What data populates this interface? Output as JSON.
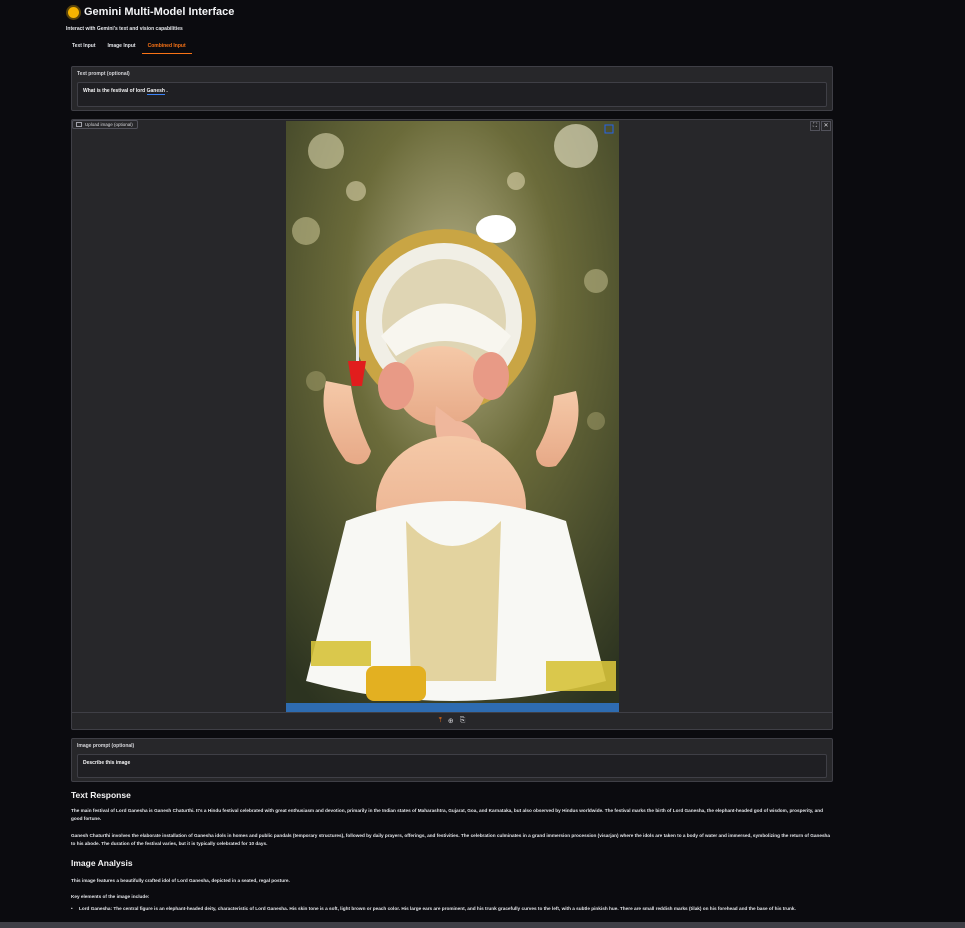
{
  "app": {
    "title": "Gemini Multi-Model Interface",
    "subtitle": "Interact with Gemini's text and vision capabilities",
    "icon": "sun-icon"
  },
  "tabs": [
    {
      "label": "Text Input",
      "active": false
    },
    {
      "label": "Image Input",
      "active": false
    },
    {
      "label": "Combined Input",
      "active": true
    }
  ],
  "text_prompt": {
    "label": "Text prompt (optional)",
    "value_before": "What is the festival of lord ",
    "value_underlined": "Ganesh",
    "value_after": " ."
  },
  "upload": {
    "label": "Upload image (optional)",
    "controls": [
      "⛶",
      "✕"
    ],
    "tools": [
      "⤒",
      "⊕",
      "⎘"
    ]
  },
  "image_prompt": {
    "label": "Image prompt (optional)",
    "value": "Describe this image"
  },
  "response": {
    "text_heading": "Text Response",
    "p1": "The main festival of Lord Ganesha is Ganesh Chaturthi. It's a Hindu festival celebrated with great enthusiasm and devotion, primarily in the Indian states of Maharashtra, Gujarat, Goa, and Karnataka, but also observed by Hindus worldwide. The festival marks the birth of Lord Ganesha, the elephant-headed god of wisdom, prosperity, and good fortune.",
    "p2": "Ganesh Chaturthi involves the elaborate installation of Ganesha idols in homes and public pandals (temporary structures), followed by daily prayers, offerings, and festivities. The celebration culminates in a grand immersion procession (visarjan) where the idols are taken to a body of water and immersed, symbolizing the return of Ganesha to his abode. The duration of the festival varies, but it is typically celebrated for 10 days.",
    "image_heading": "Image Analysis",
    "p3": "This image features a beautifully crafted idol of Lord Ganesha, depicted in a seated, regal posture.",
    "p4": "Key elements of the image include:",
    "li1": "Lord Ganesha: The central figure is an elephant-headed deity, characteristic of Lord Ganesha. His skin tone is a soft, light brown or peach color. His large ears are prominent, and his trunk gracefully curves to the left, with a subtle pinkish hue. There are small reddish marks (tilak) on his forehead and the base of his trunk."
  },
  "colors": {
    "accent": "#f97316",
    "background": "#0b0b0f",
    "panel": "#27272a"
  }
}
